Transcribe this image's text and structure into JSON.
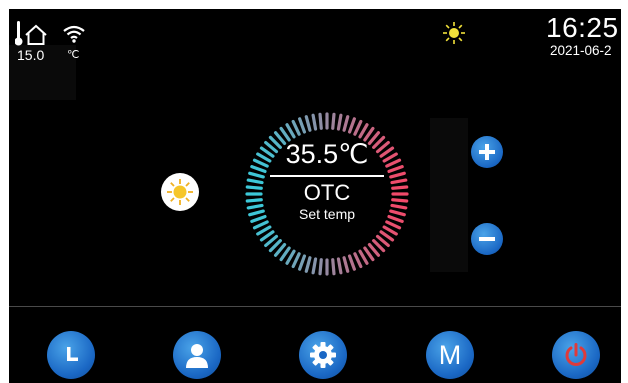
{
  "status": {
    "temperature_reading": "15.0",
    "temperature_unit": "℃",
    "icons": [
      "thermometer-home-icon",
      "wifi-icon",
      "sun-icon"
    ]
  },
  "clock": {
    "time": "16:25",
    "date": "2021-06-2"
  },
  "dial": {
    "setpoint": "35.5℃",
    "mode": "OTC",
    "caption": "Set temp",
    "gradient_colors": [
      "#3cc8d8",
      "#f04a6a"
    ]
  },
  "controls": {
    "plus_icon": "plus-icon",
    "minus_icon": "minus-icon",
    "weather_icon": "sun-icon"
  },
  "nav": {
    "items": [
      {
        "icon": "clock-icon"
      },
      {
        "icon": "user-icon"
      },
      {
        "icon": "gear-icon"
      },
      {
        "icon": "mode-icon",
        "label": "M"
      },
      {
        "icon": "power-icon",
        "color": "#e03a3a"
      }
    ]
  },
  "colors": {
    "accent": "#1f6fd0",
    "background": "#000000"
  }
}
